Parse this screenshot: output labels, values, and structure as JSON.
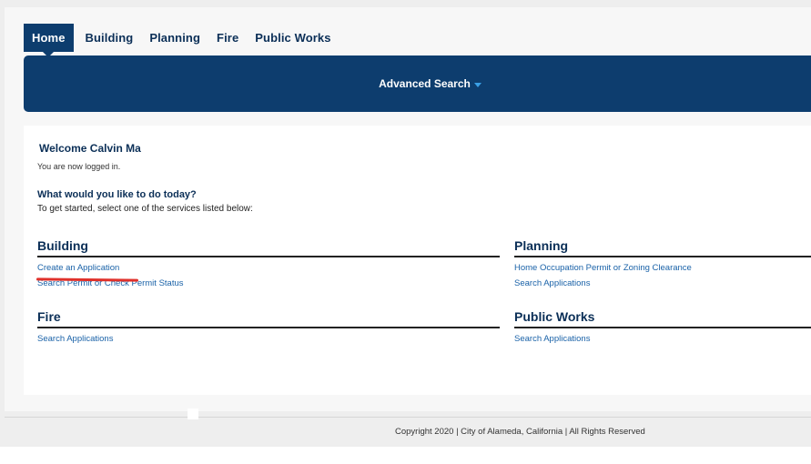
{
  "nav": {
    "tabs": [
      {
        "label": "Home",
        "active": true
      },
      {
        "label": "Building"
      },
      {
        "label": "Planning"
      },
      {
        "label": "Fire"
      },
      {
        "label": "Public Works"
      }
    ]
  },
  "banner": {
    "search_label": "Advanced Search",
    "search_icon": "caret-down-icon"
  },
  "welcome": {
    "title": "Welcome Calvin Ma",
    "status": "You are now logged in.",
    "question": "What would you like to do today?",
    "instructions": "To get started, select one of the services listed below:"
  },
  "sections": {
    "building": {
      "title": "Building",
      "links": [
        "Create an Application",
        "Search Permit or Check Permit Status"
      ]
    },
    "planning": {
      "title": "Planning",
      "links": [
        "Home Occupation Permit or Zoning Clearance",
        "Search Applications"
      ]
    },
    "fire": {
      "title": "Fire",
      "links": [
        "Search Applications"
      ]
    },
    "public_works": {
      "title": "Public Works",
      "links": [
        "Search Applications"
      ]
    }
  },
  "footer": {
    "copyright": "Copyright 2020 | City of Alameda, California | All Rights Reserved"
  },
  "colors": {
    "navy": "#0d3d6e",
    "link": "#1a62a8",
    "annotation": "#e0312b"
  }
}
